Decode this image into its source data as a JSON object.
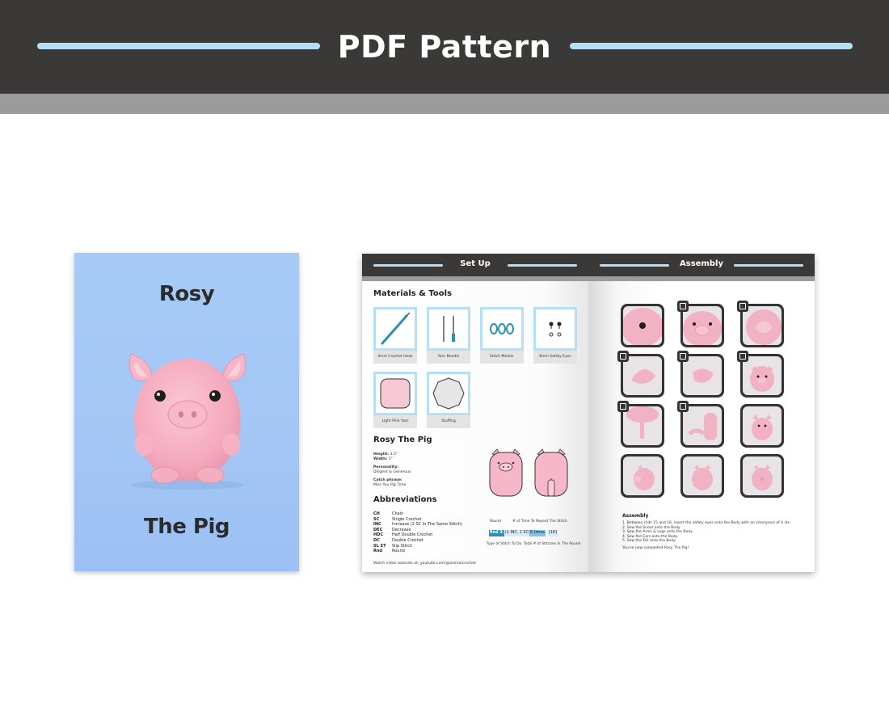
{
  "header": {
    "title": "PDF Pattern"
  },
  "cover": {
    "title_top": "Rosy",
    "title_bottom": "The Pig"
  },
  "left_page": {
    "heading": "Set Up",
    "materials_title": "Materials & Tools",
    "tools": [
      "4mm Crochet Hook",
      "Yarn Needle",
      "Stitch Marker",
      "8mm Safety Eyes",
      "Light Pink Yarn",
      "Stuffing"
    ],
    "pig_title": "Rosy The Pig",
    "height_label": "Height:",
    "height_value": "3.5\"",
    "width_label": "Width:",
    "width_value": "3\"",
    "personality_label": "Personality:",
    "personality_value": "Diligent & Generous",
    "catchphrase_label": "Catch phrase:",
    "catchphrase_value": "Miss You Pig Time",
    "abbr_title": "Abbreviations",
    "abbreviations": [
      {
        "k": "CH",
        "v": "Chain"
      },
      {
        "k": "SC",
        "v": "Single Crochet"
      },
      {
        "k": "INC",
        "v": "Increase (2 SC In The Same Stitch)"
      },
      {
        "k": "DEC",
        "v": "Decrease"
      },
      {
        "k": "HDC",
        "v": "Half Double Crochet"
      },
      {
        "k": "DC",
        "v": "Double Crochet"
      },
      {
        "k": "SL ST",
        "v": "Slip Stitch"
      },
      {
        "k": "Rnd",
        "v": "Round"
      }
    ],
    "diagram": {
      "round_label": "Round",
      "repeat_label": "# of Time To Repeat The Stitch",
      "rnd": "Rnd 3:",
      "stitch": "(1 INC, 1 SC)",
      "times": "6 times",
      "total": "[18]",
      "type_label": "Type of Stitch To Do",
      "total_label": "Total # of Stitches In The Round"
    },
    "footer": "Watch video tutorials at: youtube.com/@animalcrochet"
  },
  "right_page": {
    "heading": "Assembly",
    "assembly_title": "Assembly",
    "steps": [
      "1. Between rnds 15 and 16, insert the safety eyes onto the Body with an interspace of 4 sts.",
      "2. Sew the Snout onto the Body.",
      "3. Sew the Arms & Legs onto the Body.",
      "4. Sew the Ears onto the Body.",
      "5. Sew the Tail onto the Body."
    ],
    "closing": "You've now completed Rosy The Pig!"
  },
  "colors": {
    "header_bg": "#3a3938",
    "accent": "#b3e0f7",
    "pig_pink": "#f6b3c6",
    "cover_blue": "#a3c6f5"
  }
}
